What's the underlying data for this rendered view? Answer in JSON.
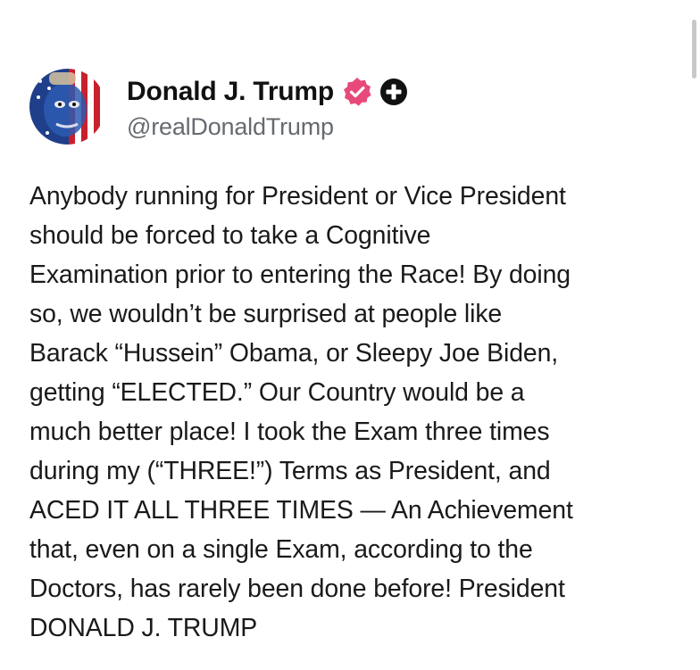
{
  "post": {
    "author": {
      "display_name": "Donald J. Trump",
      "handle": "@realDonaldTrump",
      "verified_badge_icon": "verified-badge-icon",
      "verified_badge_color": "#e74a7a",
      "plus_badge_icon": "plus-badge-icon",
      "plus_badge_color": "#111111"
    },
    "body_lines": [
      "Anybody running for President or Vice President",
      "should be forced to take a Cognitive",
      "Examination prior to entering the Race! By doing",
      "so, we wouldn’t be surprised at people like",
      "Barack “Hussein” Obama, or Sleepy Joe Biden,",
      "getting “ELECTED.” Our Country would be a",
      "much better place! I took the Exam three times",
      "during my (“THREE!”) Terms as President, and",
      "ACED IT ALL THREE TIMES — An Achievement",
      "that, even on a single Exam, according to the",
      "Doctors, has rarely been done before! President",
      "DONALD J. TRUMP"
    ]
  }
}
